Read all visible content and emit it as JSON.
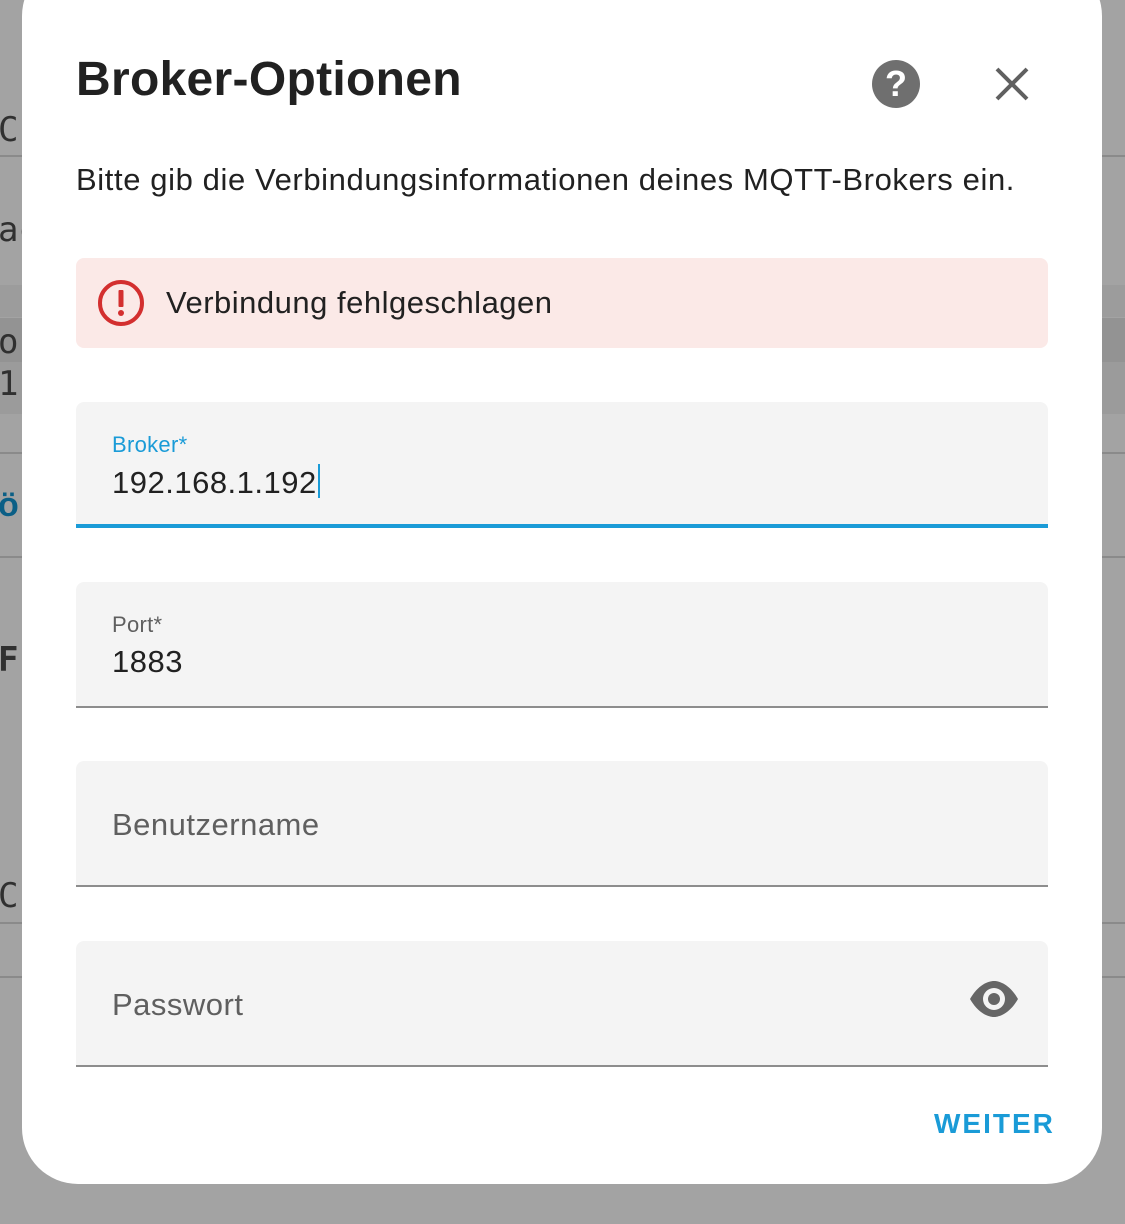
{
  "background": {
    "fragments": [
      "C",
      "ac",
      "or",
      "1",
      "ö",
      "F",
      "C"
    ]
  },
  "dialog": {
    "title": "Broker-Optionen",
    "help_icon": "help-circle-icon",
    "close_icon": "close-icon",
    "description": "Bitte gib die Verbindungsinformationen deines MQTT-Brokers ein.",
    "alert": {
      "icon": "alert-circle-icon",
      "message": "Verbindung fehlgeschlagen",
      "color": "#d32f2f",
      "background": "#fbe9e7"
    },
    "fields": {
      "broker": {
        "label": "Broker*",
        "value": "192.168.1.192"
      },
      "port": {
        "label": "Port*",
        "value": "1883"
      },
      "username": {
        "placeholder": "Benutzername"
      },
      "password": {
        "placeholder": "Passwort",
        "toggle_icon": "eye-icon"
      }
    },
    "submit_label": "WEITER",
    "accent_color": "#1a9bd7"
  }
}
